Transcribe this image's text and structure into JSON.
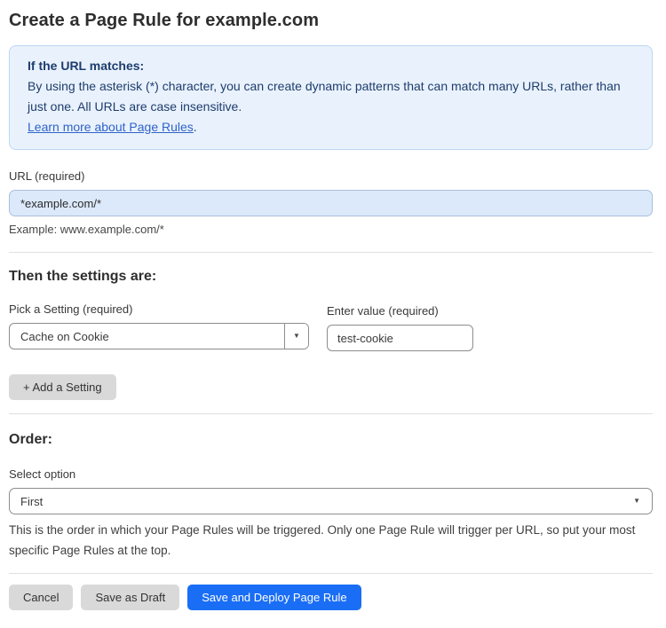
{
  "page": {
    "title": "Create a Page Rule for example.com"
  },
  "info_box": {
    "heading": "If the URL matches:",
    "body": "By using the asterisk (*) character, you can create dynamic patterns that can match many URLs, rather than just one. All URLs are case insensitive.",
    "link_text": "Learn more about Page Rules",
    "link_suffix": "."
  },
  "url_section": {
    "label": "URL (required)",
    "value": "*example.com/*",
    "helper": "Example: www.example.com/*"
  },
  "settings_section": {
    "heading": "Then the settings are:",
    "setting_label": "Pick a Setting (required)",
    "setting_selected": "Cache on Cookie",
    "value_label": "Enter value (required)",
    "value_text": "test-cookie",
    "add_button_label": "+ Add a Setting"
  },
  "order_section": {
    "heading": "Order:",
    "label": "Select option",
    "selected": "First",
    "helper": "This is the order in which your Page Rules will be triggered. Only one Page Rule will trigger per URL, so put your most specific Page Rules at the top."
  },
  "actions": {
    "cancel_label": "Cancel",
    "save_draft_label": "Save as Draft",
    "save_deploy_label": "Save and Deploy Page Rule"
  },
  "icons": {
    "dropdown_caret": "▼"
  },
  "colors": {
    "info_background": "#e9f2fc",
    "info_border": "#bdd7f5",
    "info_text": "#1e3c6d",
    "link_blue": "#2f62c9",
    "url_input_background": "#dce9fb",
    "primary_button_blue": "#1a6ef5",
    "gray_button": "#d9d9d9"
  }
}
